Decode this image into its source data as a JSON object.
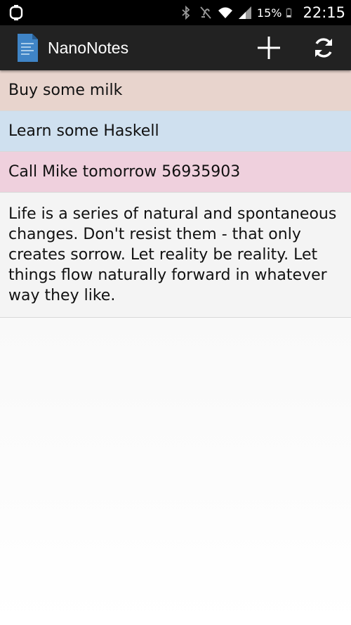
{
  "status_bar": {
    "left_icon": "notification-icon",
    "icons": [
      "bluetooth-icon",
      "vibrate-off-icon",
      "wifi-icon",
      "signal-icon"
    ],
    "battery_percent": "15%",
    "battery_icon": "battery-icon",
    "clock": "22:15"
  },
  "action_bar": {
    "app_icon": "note-document-icon",
    "title": "NanoNotes",
    "actions": [
      {
        "name": "add",
        "icon": "plus-icon"
      },
      {
        "name": "refresh",
        "icon": "refresh-icon"
      }
    ]
  },
  "notes": [
    {
      "text": "Buy some milk",
      "color": "#e8d4cd"
    },
    {
      "text": "Learn some Haskell",
      "color": "#cfe0ef"
    },
    {
      "text": "Call Mike tomorrow 56935903",
      "color": "#efd0dd"
    },
    {
      "text": "Life is a series of natural and spontaneous changes. Don't resist them - that only creates sorrow. Let reality be reality. Let things flow naturally forward in whatever way they like.",
      "color": "#f4f4f4"
    }
  ],
  "colors": {
    "status_bar_bg": "#000000",
    "action_bar_bg": "#222222",
    "list_bg": "#f7f7f7"
  }
}
